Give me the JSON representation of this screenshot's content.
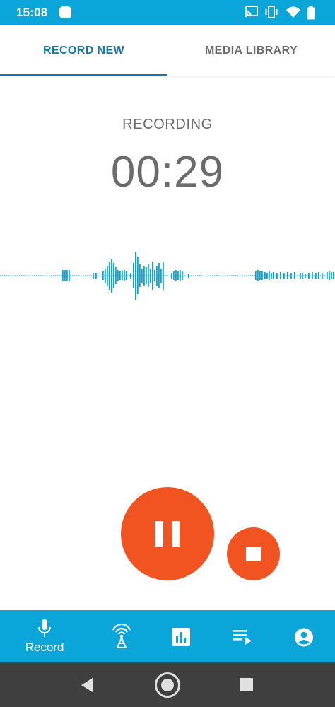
{
  "status_bar": {
    "time": "15:08",
    "icons": [
      "notification-icon",
      "cast-icon",
      "vibrate-icon",
      "wifi-icon",
      "battery-icon"
    ]
  },
  "tabs": [
    {
      "label": "RECORD NEW",
      "selected": true
    },
    {
      "label": "MEDIA LIBRARY",
      "selected": false
    }
  ],
  "recording": {
    "status": "RECORDING",
    "timer": "00:29"
  },
  "controls": {
    "pause_icon": "pause-icon",
    "stop_icon": "stop-icon"
  },
  "bottom_nav": [
    {
      "label": "Record",
      "icon": "microphone-icon"
    },
    {
      "label": "",
      "icon": "broadcast-icon"
    },
    {
      "label": "",
      "icon": "bar-chart-icon"
    },
    {
      "label": "",
      "icon": "playlist-icon"
    },
    {
      "label": "",
      "icon": "account-icon"
    }
  ],
  "colors": {
    "primary": "#0ba6d9",
    "tab_accent": "#1c74a6",
    "action": "#f25421",
    "text_secondary": "#6b6b6b",
    "system_nav": "#3f3f3f"
  }
}
